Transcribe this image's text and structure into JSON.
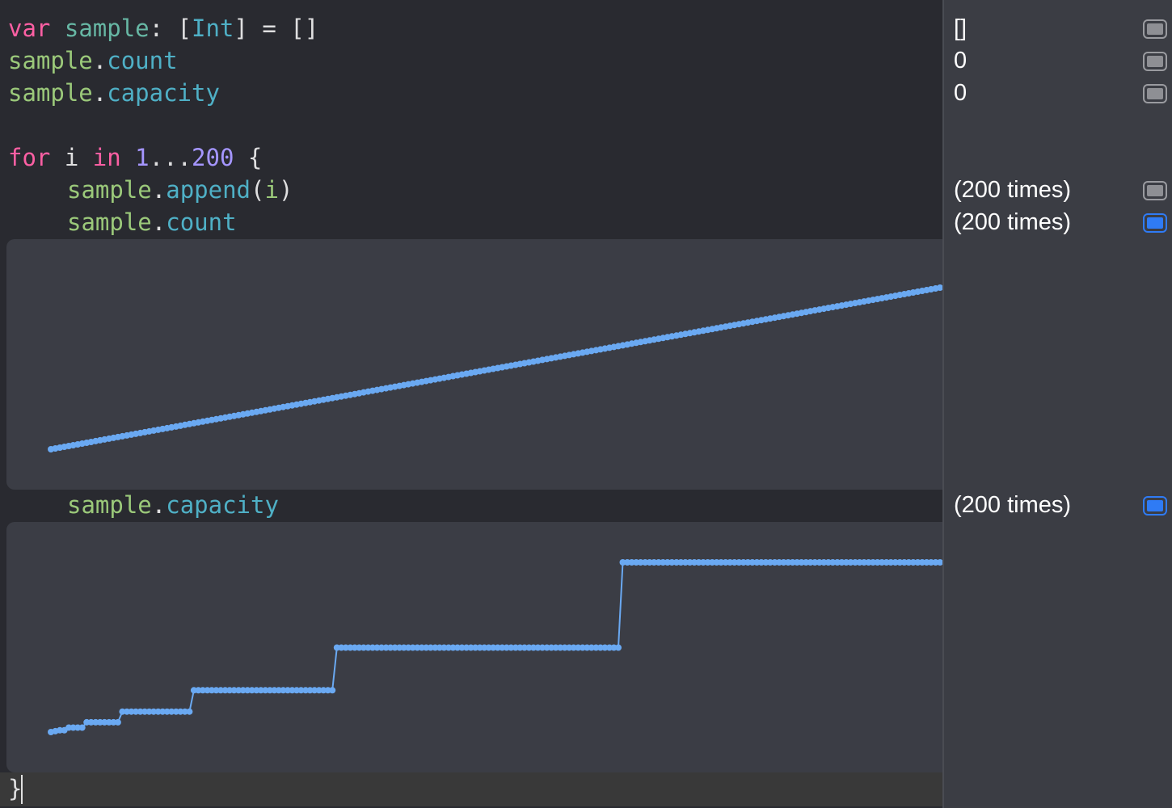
{
  "code": {
    "line1": {
      "kw": "var",
      "name": "sample",
      "colon": ": [",
      "type": "Int",
      "rest": "] = []"
    },
    "line2": {
      "obj": "sample",
      "dot": ".",
      "prop": "count"
    },
    "line3": {
      "obj": "sample",
      "dot": ".",
      "prop": "capacity"
    },
    "line5": {
      "kw_for": "for",
      "var": " i ",
      "kw_in": "in",
      "space": " ",
      "start": "1",
      "range": "...",
      "end": "200",
      "brace": " {"
    },
    "line6": {
      "obj": "sample",
      "dot": ".",
      "prop": "append",
      "paren_open": "(",
      "arg": "i",
      "paren_close": ")"
    },
    "line7": {
      "obj": "sample",
      "dot": ".",
      "prop": "count"
    },
    "line8": {
      "obj": "sample",
      "dot": ".",
      "prop": "capacity"
    },
    "close": "}"
  },
  "results": {
    "r1": "[]",
    "r2": "0",
    "r3": "0",
    "r6": "(200 times)",
    "r7": "(200 times)",
    "r8": "(200 times)"
  },
  "colors": {
    "accent": "#2f7bf5",
    "plot": "#6aa9f2"
  },
  "chart_data": [
    {
      "type": "line",
      "name": "sample.count",
      "x_range": [
        1,
        200
      ],
      "y_range": [
        1,
        200
      ],
      "formula": "y = i"
    },
    {
      "type": "line",
      "name": "sample.capacity",
      "x": [
        1,
        2,
        3,
        5,
        9,
        17,
        33,
        65,
        129,
        200
      ],
      "y": [
        1,
        2,
        3,
        6,
        12,
        24,
        48,
        96,
        192,
        192
      ],
      "step": true
    }
  ]
}
